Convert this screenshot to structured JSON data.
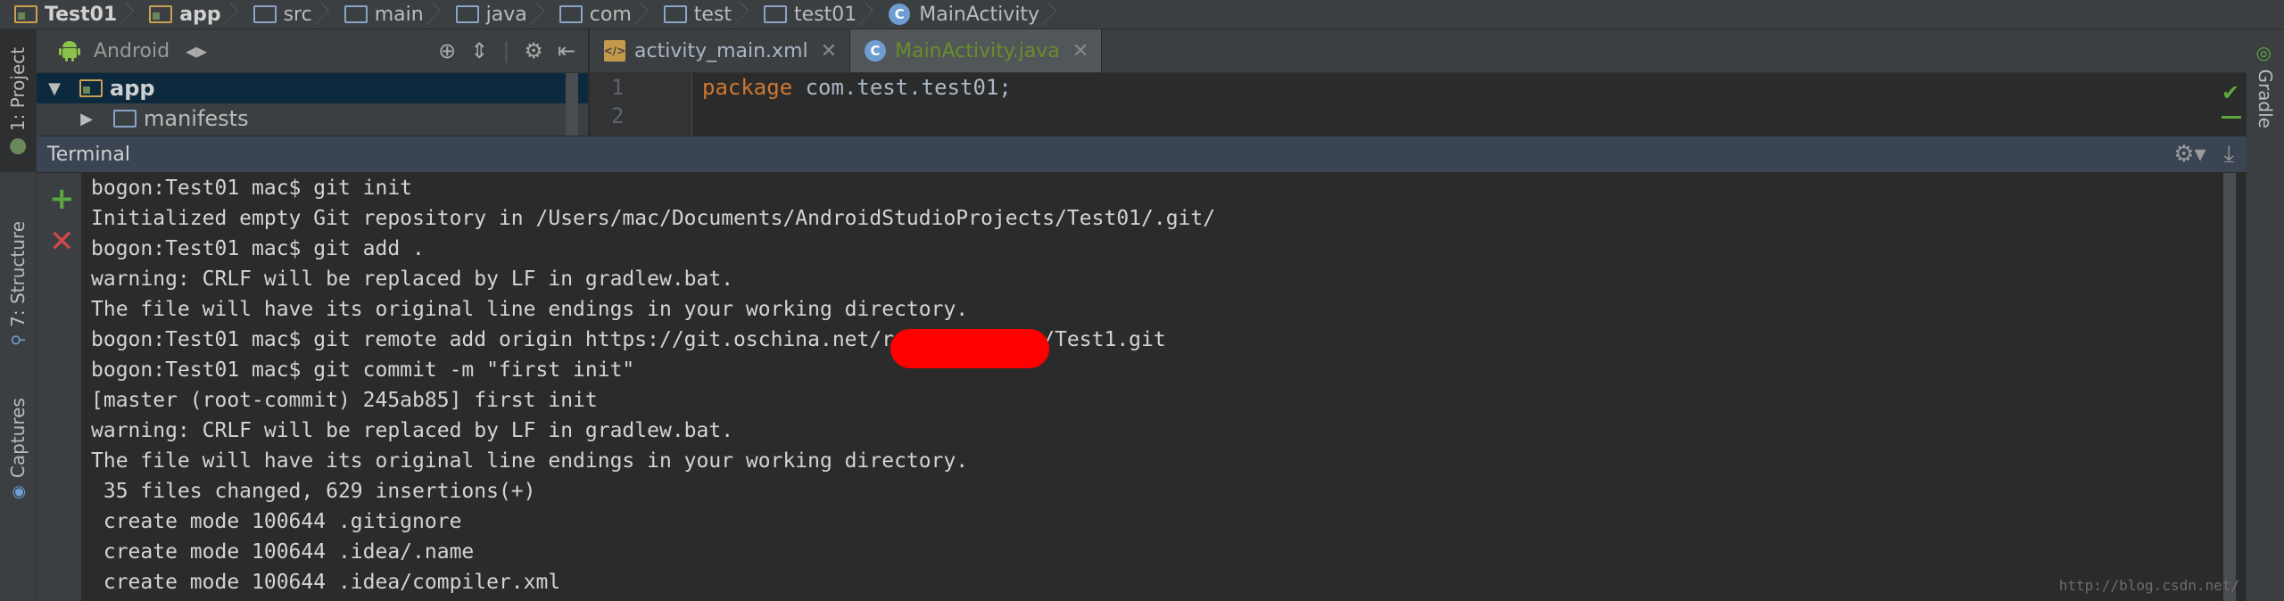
{
  "breadcrumb": [
    {
      "label": "Test01",
      "icon": "module-folder-icon"
    },
    {
      "label": "app",
      "icon": "module-folder-icon"
    },
    {
      "label": "src",
      "icon": "folder-icon"
    },
    {
      "label": "main",
      "icon": "folder-icon"
    },
    {
      "label": "java",
      "icon": "folder-icon"
    },
    {
      "label": "com",
      "icon": "package-icon"
    },
    {
      "label": "test",
      "icon": "package-icon"
    },
    {
      "label": "test01",
      "icon": "package-icon"
    },
    {
      "label": "MainActivity",
      "icon": "class-icon"
    }
  ],
  "left_strip": {
    "project_tab": "1: Project",
    "structure_tab": "7: Structure",
    "captures_tab": "Captures"
  },
  "right_strip": {
    "gradle_tab": "Gradle"
  },
  "project_panel": {
    "view_label": "Android",
    "tree": [
      {
        "label": "app",
        "expanded": true
      },
      {
        "label": "manifests",
        "expanded": false
      }
    ]
  },
  "editor": {
    "tabs": [
      {
        "label": "activity_main.xml",
        "icon": "xml-icon"
      },
      {
        "label": "MainActivity.java",
        "icon": "class-icon",
        "active": true
      }
    ],
    "line_numbers": [
      "1",
      "2"
    ],
    "code_line1_keyword": "package",
    "code_line1_rest": " com.test.test01;"
  },
  "terminal": {
    "title": "Terminal",
    "lines": [
      "bogon:Test01 mac$ git init",
      "Initialized empty Git repository in /Users/mac/Documents/AndroidStudioProjects/Test01/.git/",
      "bogon:Test01 mac$ git add .",
      "warning: CRLF will be replaced by LF in gradlew.bat.",
      "The file will have its original line endings in your working directory.",
      "bogon:Test01 mac$ git remote add origin https://git.oschina.net/r            /Test1.git",
      "bogon:Test01 mac$ git commit -m \"first init\"",
      "[master (root-commit) 245ab85] first init",
      "warning: CRLF will be replaced by LF in gradlew.bat.",
      "The file will have its original line endings in your working directory.",
      " 35 files changed, 629 insertions(+)",
      " create mode 100644 .gitignore",
      " create mode 100644 .idea/.name",
      " create mode 100644 .idea/compiler.xml"
    ]
  },
  "watermark": "http://blog.csdn.net/",
  "colors": {
    "keyword": "#cc7832",
    "active_tab_text": "#6a8e2a",
    "terminal_header": "#3a4452",
    "add_green": "#5aa83f",
    "close_red": "#d04848",
    "redaction": "#ff0000"
  }
}
